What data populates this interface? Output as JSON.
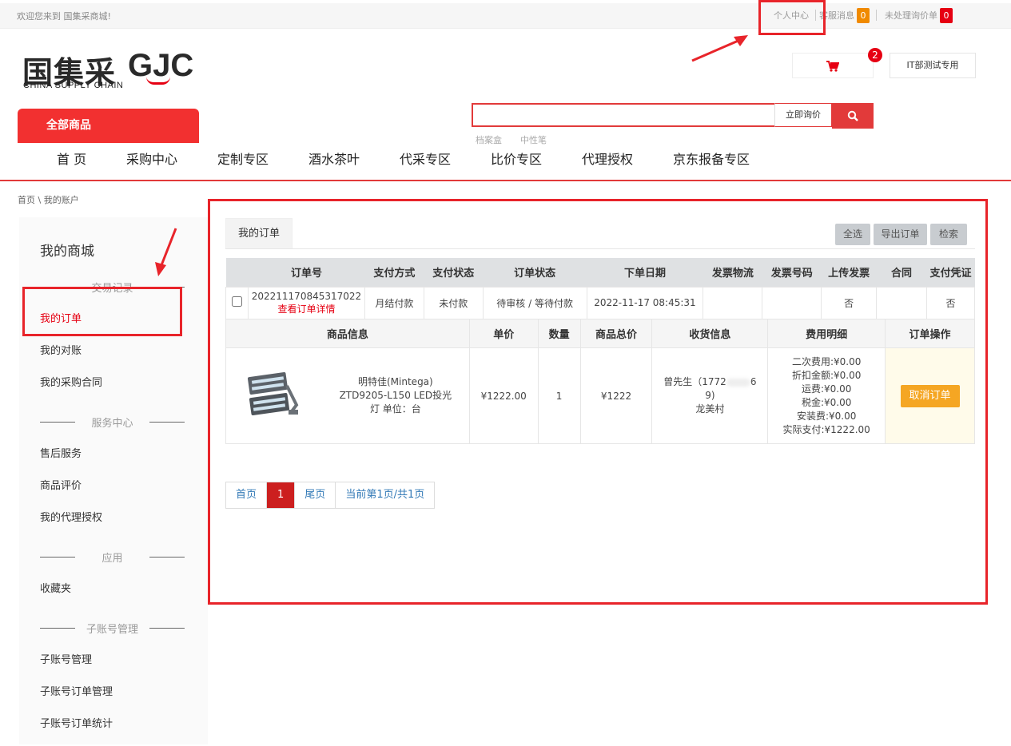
{
  "topbar": {
    "welcome": "欢迎您来到 国集采商城!",
    "personal_center": "个人中心",
    "service_msg": "客服消息",
    "service_count": "0",
    "pending_inquiry": "未处理询价单",
    "pending_count": "0"
  },
  "logo": {
    "cn": "国集采",
    "gjc": "GJC",
    "en": "CHINA SUPPLY CHAIN"
  },
  "header": {
    "cart_count": "2",
    "user_name": "IT部测试专用",
    "search_button": "立即询价",
    "hot_keywords": [
      "档案盒",
      "中性笔"
    ],
    "all_products": "全部商品"
  },
  "mainnav": [
    "首 页",
    "采购中心",
    "定制专区",
    "酒水茶叶",
    "代采专区",
    "比价专区",
    "代理授权",
    "京东报备专区"
  ],
  "breadcrumb": "首页 \\ 我的账户",
  "sidebar": {
    "title": "我的商城",
    "section_trade": "交易记录",
    "my_orders": "我的订单",
    "my_reconciliation": "我的对账",
    "my_contracts": "我的采购合同",
    "section_service": "服务中心",
    "after_sales": "售后服务",
    "product_review": "商品评价",
    "my_agency": "我的代理授权",
    "section_app": "应用",
    "favorites": "收藏夹",
    "section_sub": "子账号管理",
    "sub_manage": "子账号管理",
    "sub_orders": "子账号订单管理",
    "sub_stats": "子账号订单统计"
  },
  "orders": {
    "tab": "我的订单",
    "select_all": "全选",
    "export": "导出订单",
    "search": "检索",
    "headers": [
      "订单号",
      "支付方式",
      "支付状态",
      "订单状态",
      "下单日期",
      "发票物流",
      "发票号码",
      "上传发票",
      "合同",
      "支付凭证"
    ],
    "order": {
      "order_no": "202211170845317022",
      "detail_link": "查看订单详情",
      "pay_method": "月结付款",
      "pay_status": "未付款",
      "order_status": "待审核 / 等待付款",
      "date": "2022-11-17 08:45:31",
      "invoice_logistics": "",
      "invoice_no": "",
      "upload_invoice": "否",
      "contract": "",
      "pay_voucher": "否"
    },
    "item_headers": [
      "商品信息",
      "单价",
      "数量",
      "商品总价",
      "收货信息",
      "费用明细",
      "订单操作"
    ],
    "item": {
      "name_line1": "明特佳(Mintega)",
      "name_line2": "ZTD9205-L150 LED投光",
      "name_line3": "灯 单位：台",
      "unit_price": "¥1222.00",
      "qty": "1",
      "total": "¥1222",
      "receiver_line1": "曾先生（1772",
      "receiver_masked": "6",
      "receiver_line2": "9)",
      "receiver_line3": "龙美村",
      "fee_secondary": "二次费用:¥0.00",
      "fee_discount": "折扣金额:¥0.00",
      "fee_shipping": "运费:¥0.00",
      "fee_tax": "税金:¥0.00",
      "fee_install": "安装费:¥0.00",
      "fee_actual": "实际支付:¥1222.00",
      "cancel": "取消订单"
    }
  },
  "pager": {
    "first": "首页",
    "current": "1",
    "last": "尾页",
    "info": "当前第1页/共1页"
  },
  "colors": {
    "brand_red": "#e23a3a",
    "annotation_red": "#e8242a",
    "cancel_orange": "#f5a623"
  }
}
